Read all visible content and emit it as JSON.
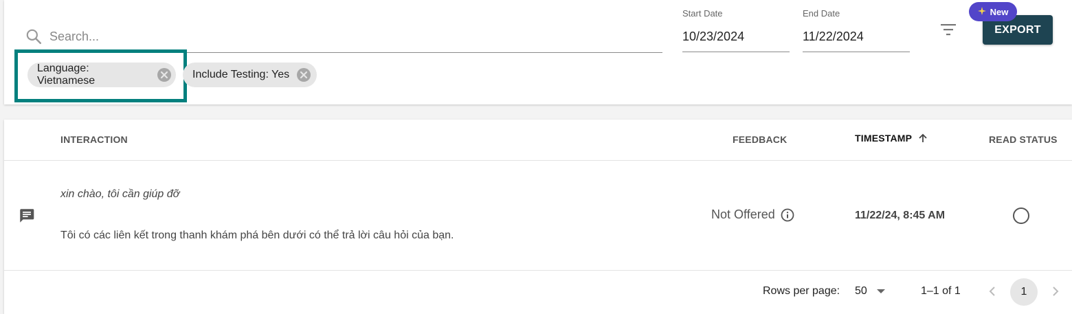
{
  "filters": {
    "search_placeholder": "Search...",
    "start_date": {
      "label": "Start Date",
      "value": "10/23/2024"
    },
    "end_date": {
      "label": "End Date",
      "value": "11/22/2024"
    },
    "export_label": "EXPORT",
    "new_badge": {
      "icon": "sparkle-icon",
      "label": "New"
    },
    "chips": [
      {
        "label": "Language: Vietnamese",
        "highlighted": true
      },
      {
        "label": "Include Testing: Yes",
        "highlighted": false
      }
    ],
    "highlight_color": "#04807e"
  },
  "table": {
    "columns": {
      "interaction": "INTERACTION",
      "feedback": "FEEDBACK",
      "timestamp": "TIMESTAMP",
      "read_status": "READ STATUS"
    },
    "sort": {
      "column": "timestamp",
      "direction": "ascending"
    },
    "rows": [
      {
        "icon": "chat-icon",
        "question": "xin chào, tôi cần giúp đỡ",
        "answer": "Tôi có các liên kết trong thanh khám phá bên dưới có thể trả lời câu hỏi của bạn.",
        "feedback": "Not Offered",
        "timestamp": "11/22/24, 8:45 AM",
        "read": false
      }
    ]
  },
  "pagination": {
    "rows_per_page_label": "Rows per page:",
    "rows_per_page_value": "50",
    "range": "1–1 of 1",
    "current_page": "1"
  },
  "colors": {
    "export_button": "#1e4452",
    "new_badge": "#5245c9",
    "chip_bg": "#e6e6e6"
  }
}
